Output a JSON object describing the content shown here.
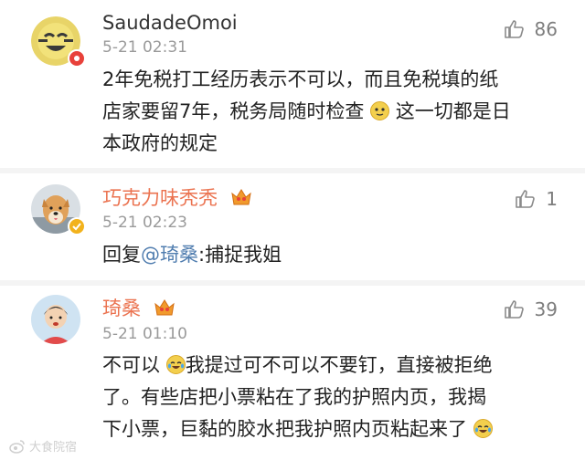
{
  "comments": [
    {
      "username": "SaudadeOmoi",
      "timestamp": "5-21 02:31",
      "likes": "86",
      "text_part1": "2年免税打工经历表示不可以，而且免税填的纸",
      "text_part2": "店家要留7年，税务局随时检查",
      "text_part3": "这一切都是日",
      "text_part4": "本政府的规定",
      "username_color": "#333333",
      "emoji_name": "doge-emoji"
    },
    {
      "username": "巧克力味秃秃",
      "timestamp": "5-21 02:23",
      "likes": "1",
      "reply_prefix": "回复",
      "mention": "@琦桑",
      "reply_suffix": ":捕捉我姐",
      "username_color": "#eb7350"
    },
    {
      "username": "琦桑",
      "timestamp": "5-21 01:10",
      "likes": "39",
      "text_part1": "不可以",
      "text_part2": "我提过可不可以不要钉，直接被拒绝",
      "text_part3": "了。有些店把小票粘在了我的护照内页，我揭",
      "text_part4": "下小票，巨黏的胶水把我护照内页粘起来了",
      "username_color": "#eb7350",
      "emoji_name": "laugh-cry-emoji"
    }
  ],
  "watermark": "大食院宿",
  "colors": {
    "orange_name": "#eb7350",
    "mention": "#507daf",
    "time": "#9a9a9a"
  }
}
